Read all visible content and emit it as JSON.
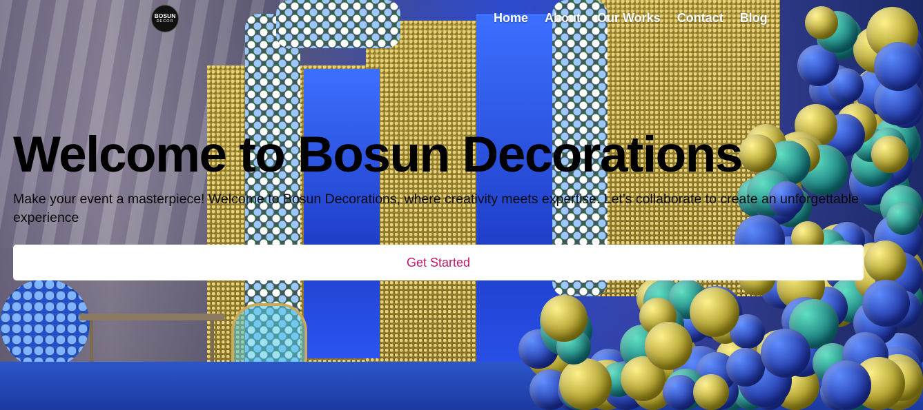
{
  "brand": {
    "logo_top": "BOSUN",
    "logo_bottom": "DECOR"
  },
  "nav": {
    "items": [
      {
        "label": "Home"
      },
      {
        "label": "About"
      },
      {
        "label": "Our Works"
      },
      {
        "label": "Contact"
      },
      {
        "label": "Blog"
      }
    ]
  },
  "hero": {
    "title": "Welcome to Bosun Decorations",
    "description": "Make your event a masterpiece! Welcome to Bosun Decorations, where creativity meets expertise. Let's collaborate to create an unforgettable experience",
    "cta_label": "Get Started"
  },
  "colors": {
    "cta_text": "#c2176b",
    "cta_bg": "#ffffff",
    "nav_text": "#ffffff",
    "title": "#000000"
  }
}
